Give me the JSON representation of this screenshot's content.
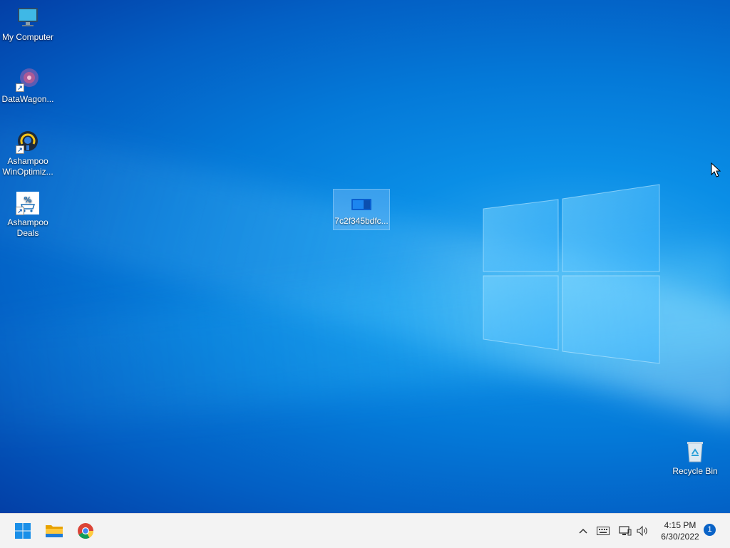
{
  "desktop": {
    "icons": [
      {
        "label": "My Computer",
        "icon": "monitor-icon"
      },
      {
        "label": "DataWagon...",
        "icon": "datawagon-icon"
      },
      {
        "label": "Ashampoo WinOptimiz...",
        "icon": "winoptimizer-icon"
      },
      {
        "label": "Ashampoo Deals",
        "icon": "deals-icon"
      },
      {
        "label": "7c2f345bdfc...",
        "icon": "file-icon"
      },
      {
        "label": "Recycle Bin",
        "icon": "recycle-bin-icon"
      }
    ]
  },
  "taskbar": {
    "pinned": [
      {
        "name": "Start",
        "icon": "windows-start-icon"
      },
      {
        "name": "File Explorer",
        "icon": "folder-icon"
      },
      {
        "name": "Google Chrome",
        "icon": "chrome-icon"
      }
    ],
    "tray": {
      "icons": [
        "chevron-up-icon",
        "keyboard-icon",
        "network-icon",
        "volume-icon"
      ],
      "time": "4:15 PM",
      "date": "6/30/2022",
      "notification_count": "1"
    }
  },
  "colors": {
    "accent": "#0a63c7",
    "taskbar_bg": "#f3f3f3"
  }
}
